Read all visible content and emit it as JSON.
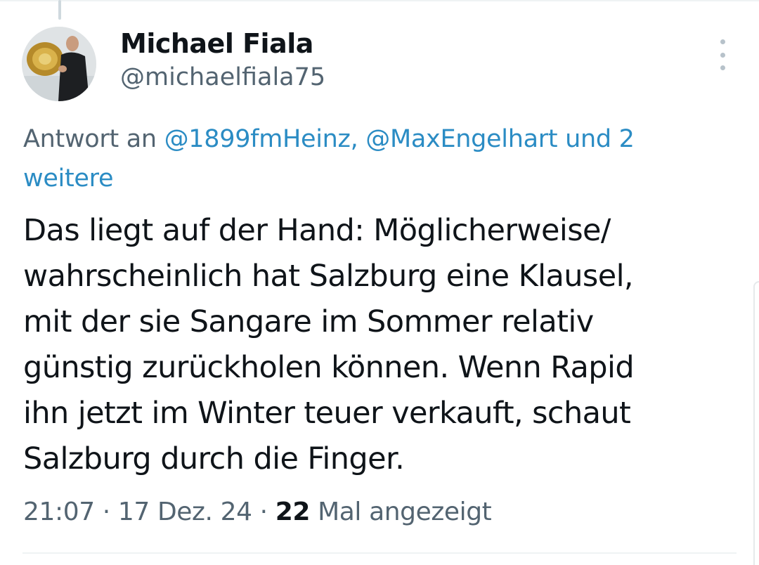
{
  "tweet": {
    "author": {
      "name": "Michael Fiala",
      "handle": "@michaelfiala75",
      "avatar_icon": "profile-photo"
    },
    "reply_context": {
      "prefix": "Antwort an ",
      "mention_1": "@1899fmHeinz",
      "separator": ", ",
      "mention_2": "@MaxEngelhart",
      "suffix": " und 2 weitere"
    },
    "text": "Das liegt auf der Hand: Möglicherweise/\nwahrscheinlich hat Salzburg eine Klausel,\nmit der sie Sangare im Sommer relativ\ngünstig zurückholen können. Wenn Rapid\nihn jetzt im Winter teuer verkauft, schaut\nSalzburg durch die Finger.",
    "meta": {
      "time": "21:07",
      "sep1": " · ",
      "date": "17 Dez. 24",
      "sep2": " · ",
      "views_count": "22",
      "views_label": " Mal angezeigt"
    },
    "more_icon": "more-vertical-icon"
  },
  "colors": {
    "text": "#0f1419",
    "secondary": "#536471",
    "link": "#2b8cc4",
    "border": "#eff3f4"
  }
}
